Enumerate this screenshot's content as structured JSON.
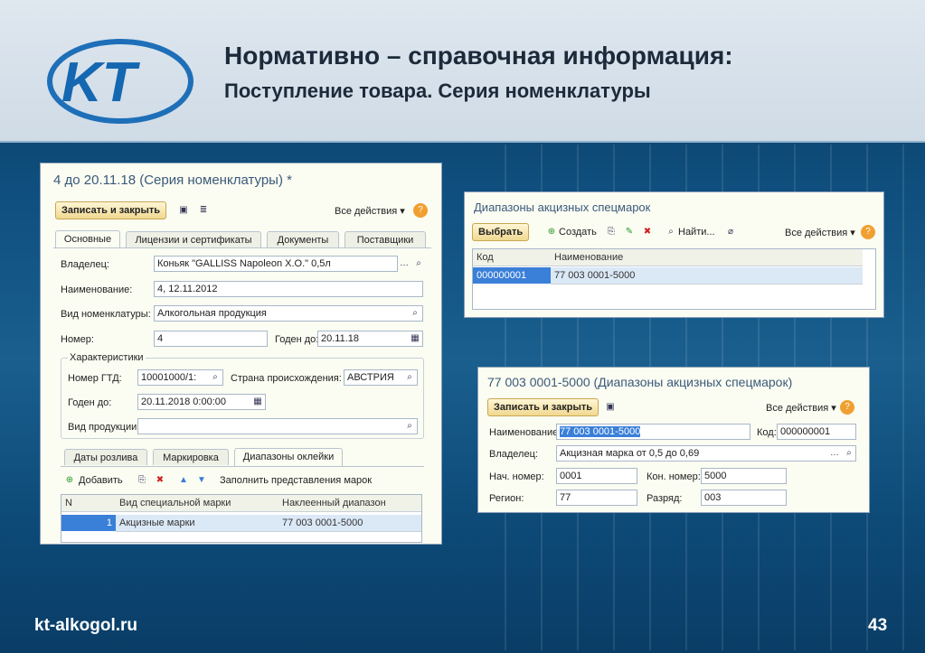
{
  "slide": {
    "title1": "Нормативно – справочная информация:",
    "title2": "Поступление товара. Серия номенклатуры",
    "footer_site": "kt-alkogol.ru",
    "page_number": "43",
    "logo_text": "KT"
  },
  "win1": {
    "title": "4 до 20.11.18 (Серия номенклатуры) *",
    "save_close": "Записать и закрыть",
    "all_actions": "Все действия ▾",
    "help": "?",
    "tabs": [
      "Основные",
      "Лицензии и сертификаты",
      "Документы",
      "Поставщики"
    ],
    "owner_label": "Владелец:",
    "owner_value": "Коньяк \"GALLISS Napoleon X.O.\" 0,5л",
    "name_label": "Наименование:",
    "name_value": "4, 12.11.2012",
    "kind_label": "Вид номенклатуры:",
    "kind_value": "Алкогольная продукция",
    "number_label": "Номер:",
    "number_value": "4",
    "valid_label": "Годен до:",
    "valid_value": "20.11.18",
    "group_label": "Характеристики",
    "gtd_label": "Номер ГТД:",
    "gtd_value": "10001000/1:",
    "country_label": "Страна происхождения:",
    "country_value": "АВСТРИЯ",
    "valid2_label": "Годен до:",
    "valid2_value": "20.11.2018  0:00:00",
    "prodkind_label": "Вид продукции:",
    "prodkind_value": "",
    "subtabs": [
      "Даты розлива",
      "Маркировка",
      "Диапазоны оклейки"
    ],
    "add_label": "Добавить",
    "fill_label": "Заполнить представления марок",
    "cols": [
      "N",
      "Вид специальной марки",
      "Наклеенный диапазон"
    ],
    "row": {
      "n": "1",
      "kind": "Акцизные марки",
      "range": "77 003 0001-5000"
    }
  },
  "win2": {
    "title": "Диапазоны акцизных спецмарок",
    "select": "Выбрать",
    "create": "Создать",
    "find": "Найти...",
    "all_actions": "Все действия ▾",
    "help": "?",
    "cols": [
      "Код",
      "Наименование"
    ],
    "row": {
      "code": "000000001",
      "name": "77 003 0001-5000"
    }
  },
  "win3": {
    "title": "77 003 0001-5000 (Диапазоны акцизных спецмарок)",
    "save_close": "Записать и закрыть",
    "all_actions": "Все действия ▾",
    "help": "?",
    "name_label": "Наименование:",
    "name_value": "77 003 0001-5000",
    "code_label": "Код:",
    "code_value": "000000001",
    "owner_label": "Владелец:",
    "owner_value": "Акцизная марка от 0,5 до 0,69",
    "start_label": "Нач. номер:",
    "start_value": "0001",
    "end_label": "Кон. номер:",
    "end_value": "5000",
    "region_label": "Регион:",
    "region_value": "77",
    "rank_label": "Разряд:",
    "rank_value": "003"
  }
}
